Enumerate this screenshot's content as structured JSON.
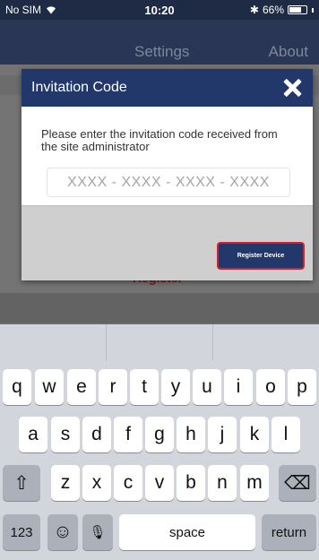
{
  "status_bar": {
    "carrier": "No SIM",
    "time": "10:20",
    "battery": "66%"
  },
  "nav": {
    "settings": "Settings",
    "about": "About"
  },
  "background_partial_text": "Register",
  "dialog": {
    "title": "Invitation Code",
    "message": "Please enter the invitation code received from the site administrator",
    "code_placeholder": "XXXX - XXXX - XXXX - XXXX",
    "register_button": "Register Device"
  },
  "keyboard": {
    "row1": [
      "q",
      "w",
      "e",
      "r",
      "t",
      "y",
      "u",
      "i",
      "o",
      "p"
    ],
    "row2": [
      "a",
      "s",
      "d",
      "f",
      "g",
      "h",
      "j",
      "k",
      "l"
    ],
    "row3": [
      "z",
      "x",
      "c",
      "v",
      "b",
      "n",
      "m"
    ],
    "numbers_key": "123",
    "space_key": "space",
    "return_key": "return",
    "shift_icon": "⇧",
    "delete_icon": "⌫",
    "emoji_icon": "☺",
    "mic_icon": "🎙"
  },
  "colors": {
    "header": "#22376a",
    "button_border": "#d4202f"
  }
}
